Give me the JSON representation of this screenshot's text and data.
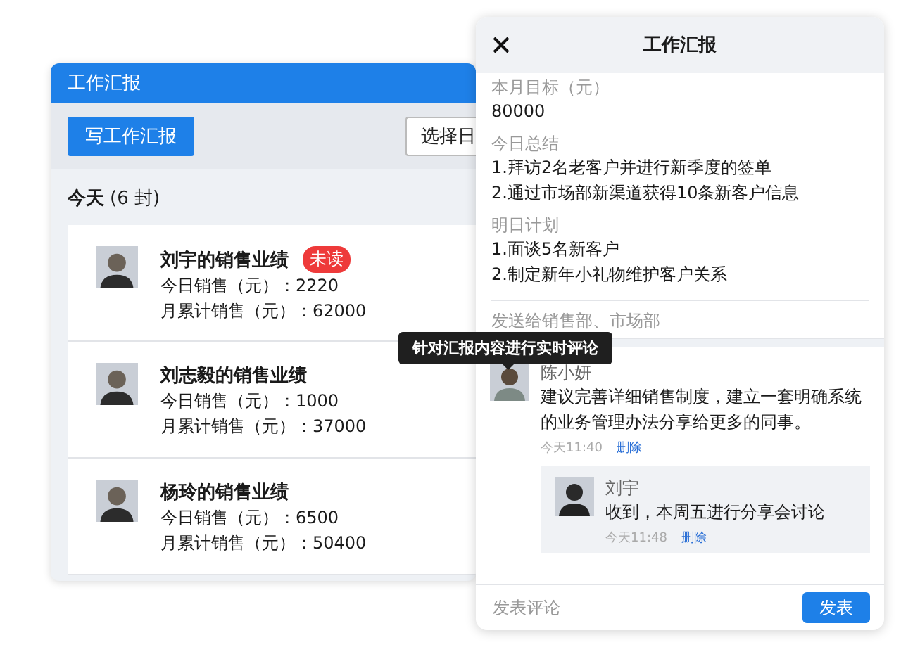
{
  "left_window": {
    "title": "工作汇报",
    "write_button": "写工作汇报",
    "date_button": "选择日",
    "group": {
      "label": "今天",
      "count": "(6 封)"
    },
    "reports": [
      {
        "title": "刘宇的销售业绩",
        "badge": "未读",
        "today": "今日销售（元）：2220",
        "month": "月累计销售（元）：62000"
      },
      {
        "title": "刘志毅的销售业绩",
        "today": "今日销售（元）：1000",
        "month": "月累计销售（元）：37000"
      },
      {
        "title": "杨玲的销售业绩",
        "today": "今日销售（元）：6500",
        "month": "月累计销售（元）：50400"
      }
    ]
  },
  "detail_window": {
    "title": "工作汇报",
    "sections": [
      {
        "label": "本月目标（元）",
        "lines": [
          "80000"
        ]
      },
      {
        "label": "今日总结",
        "lines": [
          "1.拜访2名老客户并进行新季度的签单",
          "2.通过市场部新渠道获得10条新客户信息"
        ]
      },
      {
        "label": "明日计划",
        "lines": [
          "1.面谈5名新客户",
          "2.制定新年小礼物维护客户关系"
        ]
      }
    ],
    "recipients": "发送给销售部、市场部",
    "comments": [
      {
        "author": "陈小妍",
        "text": "建议完善详细销售制度，建立一套明确系统的业务管理办法分享给更多的同事。",
        "time": "今天11:40",
        "delete": "删除",
        "replies": [
          {
            "author": "刘宇",
            "text": "收到，本周五进行分享会讨论",
            "time": "今天11:48",
            "delete": "删除"
          }
        ]
      }
    ],
    "comment_input": {
      "placeholder": "发表评论"
    },
    "submit_button": "发表"
  },
  "tooltip": "针对汇报内容进行实时评论"
}
